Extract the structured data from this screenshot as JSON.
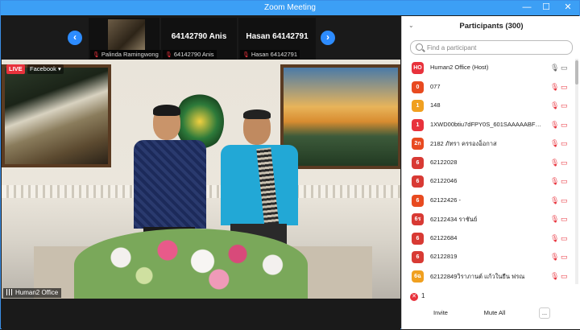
{
  "window": {
    "title": "Zoom Meeting",
    "minimize": "—",
    "maximize": "☐",
    "close": "✕"
  },
  "gallery_strip": {
    "prev": "‹",
    "next": "›",
    "thumbnails": [
      {
        "label": "Palinda Ramingwong",
        "big_name": ""
      },
      {
        "label": "64142790 Anis",
        "big_name": "64142790 Anis"
      },
      {
        "label": "Hasan 64142791",
        "big_name": "Hasan 64142791"
      }
    ]
  },
  "main_video": {
    "live_badge": "LIVE",
    "live_source": "Facebook ▾",
    "speaker_name": "Human2 Office"
  },
  "participants_panel": {
    "collapse_icon": "⌄",
    "title": "Participants (300)",
    "search_placeholder": "Find a participant",
    "participants": [
      {
        "avatar": "HO",
        "name": "Human2 Office (Host)",
        "color": "#e8323c",
        "mic": "🎙",
        "cam": "▭",
        "muted": false
      },
      {
        "avatar": "0",
        "name": "077",
        "color": "#e84a20",
        "mic": "🎙",
        "cam": "▭",
        "muted": true
      },
      {
        "avatar": "1",
        "name": "148",
        "color": "#f0a020",
        "mic": "🎙",
        "cam": "▭",
        "muted": true
      },
      {
        "avatar": "1",
        "name": "1XWD00btiu7dFPY0S_601SAAAAABFBbmRy...",
        "color": "#e8323c",
        "mic": "🎙",
        "cam": "▭",
        "muted": true
      },
      {
        "avatar": "2ก",
        "name": "2182 ภัทรา ครรองอ็อกาส",
        "color": "#e84a20",
        "mic": "🎙",
        "cam": "▭",
        "muted": true
      },
      {
        "avatar": "6",
        "name": "62122028",
        "color": "#d83a34",
        "mic": "🎙",
        "cam": "▭",
        "muted": true
      },
      {
        "avatar": "6",
        "name": "62122046",
        "color": "#d83a34",
        "mic": "🎙",
        "cam": "▭",
        "muted": true
      },
      {
        "avatar": "6",
        "name": "62122426 -",
        "color": "#e84a20",
        "mic": "🎙",
        "cam": "▭",
        "muted": true
      },
      {
        "avatar": "6ร",
        "name": "62122434 ราชันย์",
        "color": "#d83a34",
        "mic": "🎙",
        "cam": "▭",
        "muted": true
      },
      {
        "avatar": "6",
        "name": "62122684",
        "color": "#d83a34",
        "mic": "🎙",
        "cam": "▭",
        "muted": true
      },
      {
        "avatar": "6",
        "name": "62122819",
        "color": "#d83a34",
        "mic": "🎙",
        "cam": "▭",
        "muted": true
      },
      {
        "avatar": "6ฉ",
        "name": "62122849วิราภานต์ แก้วในยืน ฟรณ",
        "color": "#f0a020",
        "mic": "🎙",
        "cam": "▭",
        "muted": true
      }
    ],
    "raised_hands_count": "1",
    "raised_icon": "✕",
    "invite_label": "Invite",
    "mute_all_label": "Mute All",
    "more_label": "..."
  },
  "colors": {
    "zoom_blue": "#2d8cff",
    "titlebar": "#3c9ff5",
    "muted_red": "#e8323c"
  }
}
